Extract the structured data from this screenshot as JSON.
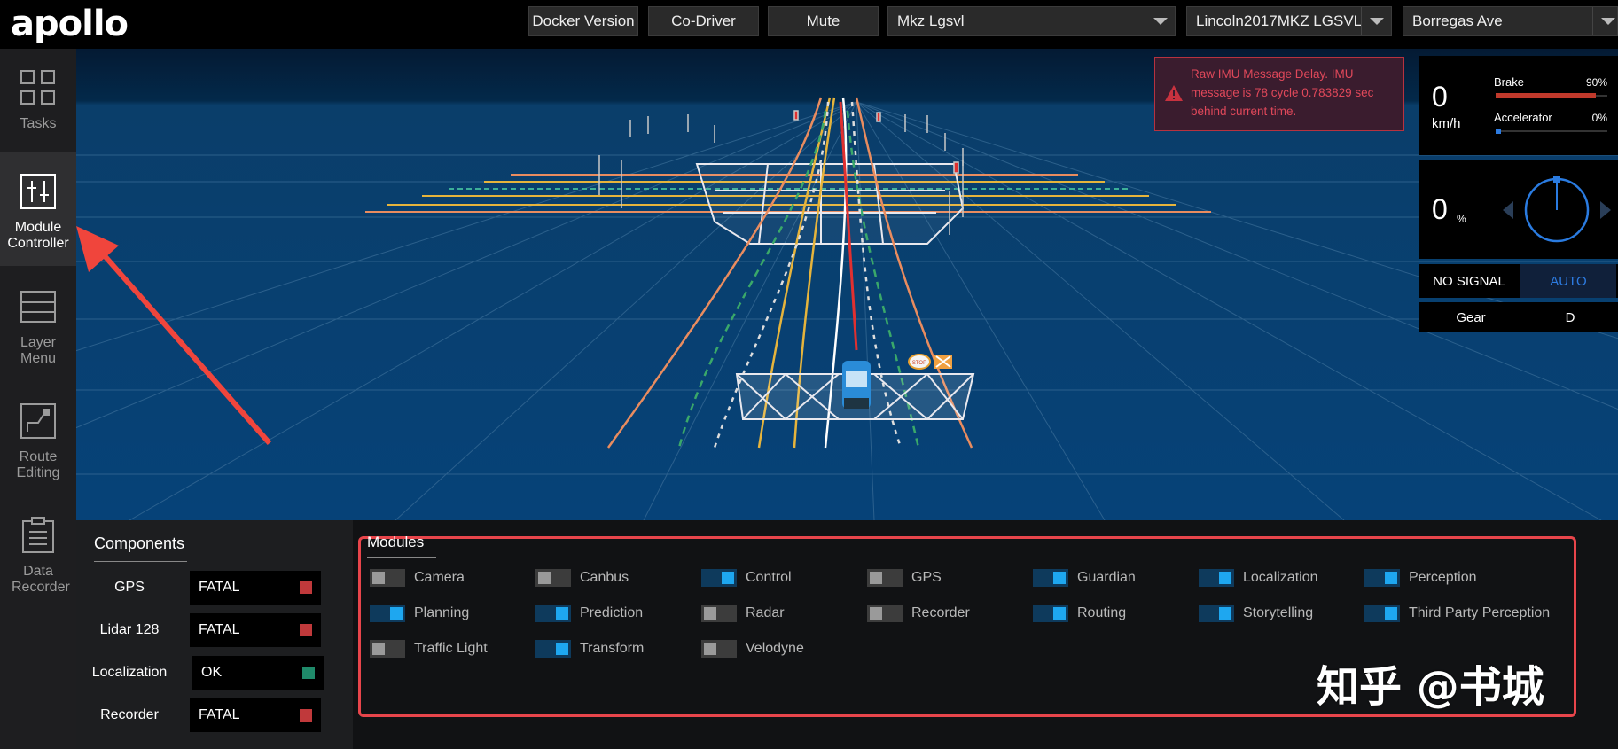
{
  "header": {
    "logo": "apollo",
    "buttons": {
      "docker": "Docker Version",
      "codriver": "Co-Driver",
      "mute": "Mute"
    },
    "selects": {
      "mode": "Mkz Lgsvl",
      "vehicle": "Lincoln2017MKZ LGSVL",
      "map": "Borregas Ave"
    }
  },
  "nav": [
    {
      "label": "Tasks",
      "icon": "grid-icon"
    },
    {
      "label": "Module Controller",
      "icon": "sliders-icon",
      "active": true
    },
    {
      "label": "Layer Menu",
      "icon": "layers-icon"
    },
    {
      "label": "Route Editing",
      "icon": "route-icon"
    },
    {
      "label": "Data Recorder",
      "icon": "clipboard-icon"
    }
  ],
  "alert": {
    "message": "Raw IMU Message Delay. IMU message is 78 cycle 0.783829 sec behind current time.",
    "color": "#e0485a"
  },
  "dashboard": {
    "speed": "0",
    "speed_unit": "km/h",
    "brake_label": "Brake",
    "brake_pct": "90%",
    "brake_value": 0.9,
    "brake_color": "#c0392b",
    "accel_label": "Accelerator",
    "accel_pct": "0%",
    "accel_value": 0.0,
    "accel_color": "#2d7be0",
    "steering": "0",
    "steering_unit": "%",
    "signal": "NO SIGNAL",
    "drive_mode": "AUTO",
    "gear_label": "Gear",
    "gear_value": "D"
  },
  "components": {
    "title": "Components",
    "rows": [
      {
        "name": "GPS",
        "status": "FATAL",
        "color": "#c0393b"
      },
      {
        "name": "Lidar 128",
        "status": "FATAL",
        "color": "#c0393b"
      },
      {
        "name": "Localization",
        "status": "OK",
        "color": "#1f8a6a"
      },
      {
        "name": "Recorder",
        "status": "FATAL",
        "color": "#c0393b"
      }
    ]
  },
  "modules": {
    "title": "Modules",
    "rows": [
      [
        {
          "name": "Camera",
          "on": false
        },
        {
          "name": "Canbus",
          "on": false
        },
        {
          "name": "Control",
          "on": true
        },
        {
          "name": "GPS",
          "on": false
        },
        {
          "name": "Guardian",
          "on": true
        },
        {
          "name": "Localization",
          "on": true
        },
        {
          "name": "Perception",
          "on": true
        }
      ],
      [
        {
          "name": "Planning",
          "on": true
        },
        {
          "name": "Prediction",
          "on": true
        },
        {
          "name": "Radar",
          "on": false
        },
        {
          "name": "Recorder",
          "on": false
        },
        {
          "name": "Routing",
          "on": true
        },
        {
          "name": "Storytelling",
          "on": true
        },
        {
          "name": "Third Party Perception",
          "on": true
        }
      ],
      [
        {
          "name": "Traffic Light",
          "on": false
        },
        {
          "name": "Transform",
          "on": true
        },
        {
          "name": "Velodyne",
          "on": false
        }
      ]
    ]
  },
  "scene": {
    "stop_sign": "STOP"
  },
  "watermark": "知乎 @书城",
  "colors": {
    "toggle_on": "#1ea7f0",
    "toggle_off": "#444",
    "accent_border": "#e8454b"
  }
}
